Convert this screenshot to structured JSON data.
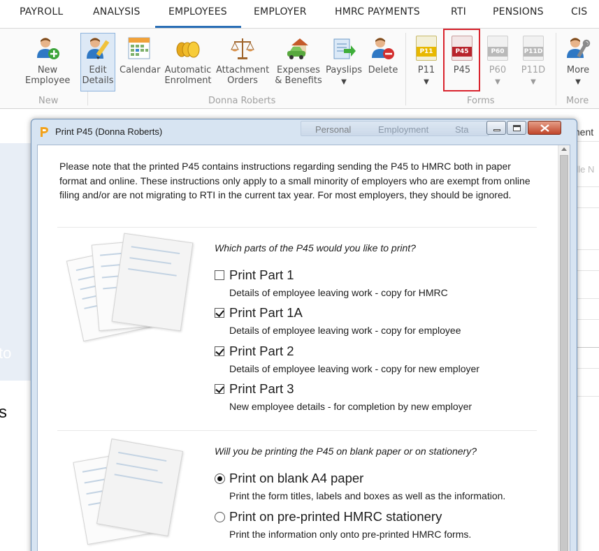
{
  "top_menu": {
    "items": [
      "PAYROLL",
      "ANALYSIS",
      "EMPLOYEES",
      "EMPLOYER",
      "HMRC PAYMENTS",
      "RTI",
      "PENSIONS",
      "CIS"
    ],
    "active": "EMPLOYEES"
  },
  "ribbon": {
    "new_employee": "New\nEmployee",
    "edit_details": "Edit\nDetails",
    "calendar": "Calendar",
    "automatic_enrolment": "Automatic\nEnrolment",
    "attachment_orders": "Attachment\nOrders",
    "expenses_benefits": "Expenses\n& Benefits",
    "payslips": "Payslips",
    "delete": "Delete",
    "p11": "P11",
    "p45": "P45",
    "p60": "P60",
    "p11d": "P11D",
    "more": "More",
    "dropdown_arrow": "▼",
    "group_new": "New",
    "group_employee": "Donna Roberts",
    "group_forms": "Forms",
    "group_more": "More",
    "icons": {
      "p11": "P11",
      "p45": "P45",
      "p60": "P60",
      "p11d": "P11D"
    }
  },
  "background": {
    "tab_personal": "Personal",
    "tab_employment": "Employment",
    "tab_third": "Sta",
    "right_text_1": "ment",
    "right_text_2": "dle N",
    "left_text_1": "to",
    "left_text_2": "s"
  },
  "dialog": {
    "title": "Print P45 (Donna Roberts)",
    "note": "Please note that the printed P45 contains instructions regarding sending the P45 to HMRC both in paper format and online. These instructions only apply to a small minority of employers who are exempt from online filing and/or are not migrating to RTI in the current tax year. For most employers, they should be ignored.",
    "parts_question": "Which parts of the P45 would you like to print?",
    "parts": [
      {
        "title": "Print Part 1",
        "desc": "Details of employee leaving work - copy for HMRC",
        "checked": false
      },
      {
        "title": "Print Part 1A",
        "desc": "Details of employee leaving work - copy for employee",
        "checked": true
      },
      {
        "title": "Print Part 2",
        "desc": "Details of employee leaving work - copy for new employer",
        "checked": true
      },
      {
        "title": "Print Part 3",
        "desc": "New employee details - for completion by new employer",
        "checked": true
      }
    ],
    "paper_question": "Will you be printing the P45 on blank paper or on stationery?",
    "paper_options": [
      {
        "title": "Print on blank A4 paper",
        "desc": "Print the form titles, labels and boxes as well as the information.",
        "selected": true
      },
      {
        "title": "Print on pre-printed HMRC stationery",
        "desc": "Print the information only onto pre-printed HMRC forms.",
        "selected": false
      }
    ]
  },
  "colors": {
    "accent": "#2a6fb6",
    "highlight_box": "#d9232d",
    "p11_yellow": "#e8b800",
    "p45_red": "#b8242c"
  }
}
